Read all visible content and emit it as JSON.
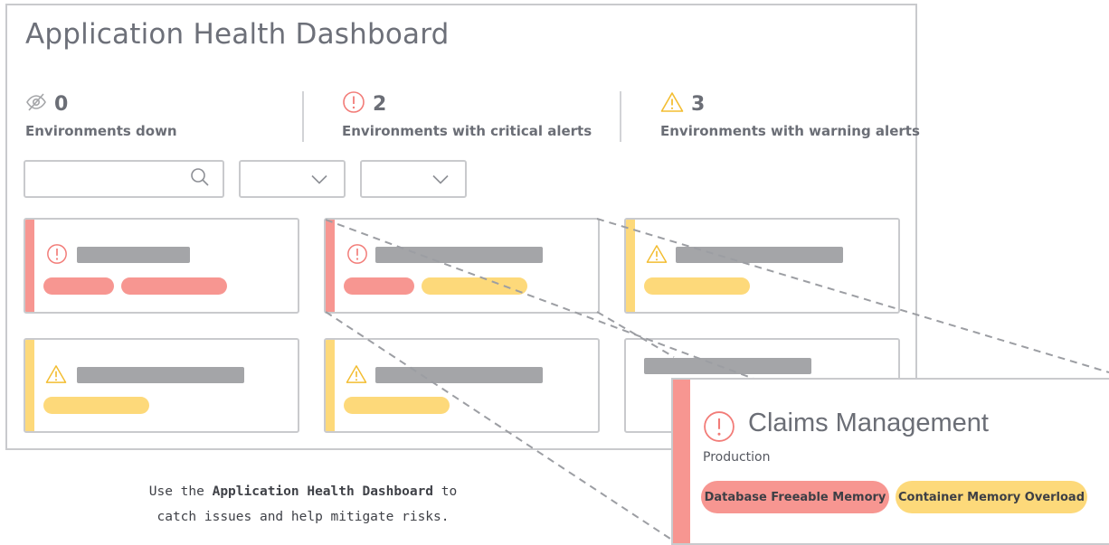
{
  "dashboard": {
    "title": "Application Health Dashboard",
    "stats": [
      {
        "count": "0",
        "label": "Environments down",
        "icon": "eye-off-icon"
      },
      {
        "count": "2",
        "label": "Environments with critical alerts",
        "icon": "critical-alert-icon"
      },
      {
        "count": "3",
        "label": "Environments with warning alerts",
        "icon": "warning-icon"
      }
    ],
    "filters": {
      "search_icon": "search-icon",
      "dropdown_icon": "chevron-down-icon"
    },
    "cards": [
      {
        "status": "critical",
        "alerts": [
          "critical",
          "critical"
        ]
      },
      {
        "status": "critical",
        "alerts": [
          "critical",
          "warning"
        ]
      },
      {
        "status": "warning",
        "alerts": [
          "warning"
        ]
      },
      {
        "status": "warning",
        "alerts": [
          "warning"
        ]
      },
      {
        "status": "warning",
        "alerts": [
          "warning"
        ]
      },
      {
        "status": "none",
        "alerts": []
      }
    ]
  },
  "detail": {
    "app_name": "Claims Management",
    "environment": "Production",
    "tags": [
      {
        "label": "Database Freeable Memory",
        "severity": "critical"
      },
      {
        "label": "Container Memory Overload",
        "severity": "warning"
      }
    ]
  },
  "caption": {
    "before": "Use the",
    "bold": "Application Health Dashboard",
    "after": "to",
    "line2": "catch issues and help mitigate risks."
  },
  "colors": {
    "critical": "#f79691",
    "warning": "#fdd97a",
    "placeholder_bar": "#a4a5a8",
    "border": "#c9cacd",
    "text": "#6b6e76"
  }
}
